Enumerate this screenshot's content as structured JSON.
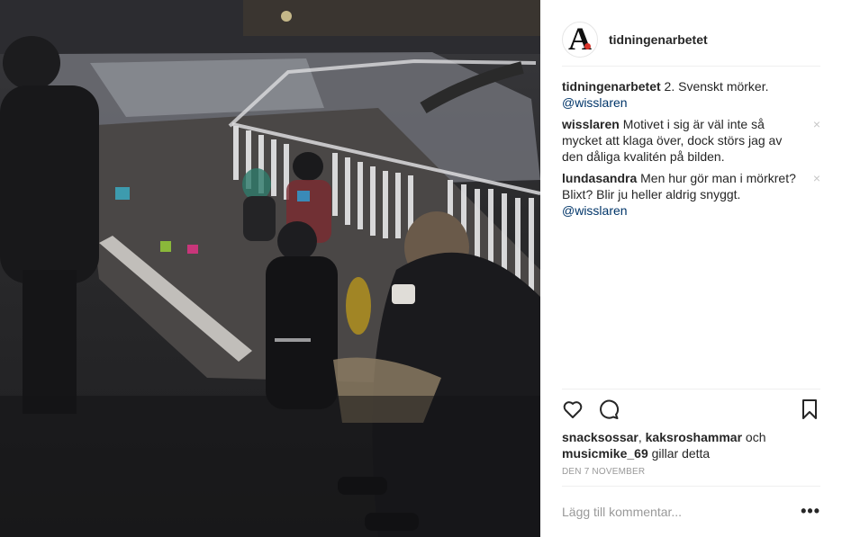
{
  "post": {
    "username": "tidningenarbetet",
    "avatar_letter": "A",
    "accent_color": "#d9342b",
    "caption_author": "tidningenarbetet",
    "caption_text": " 2. Svenskt mörker.",
    "caption_mention": "@wisslaren"
  },
  "comments": [
    {
      "author": "wisslaren",
      "text": " Motivet i sig är väl inte så mycket att klaga över, dock störs jag av den dåliga kvalitén på bilden.",
      "mention": "",
      "close": "×"
    },
    {
      "author": "lundasandra",
      "text": " Men hur gör man i mörkret? Blixt? Blir ju heller aldrig snyggt.",
      "mention": "@wisslaren",
      "close": "×"
    }
  ],
  "actions": {
    "like_icon": "heart-icon",
    "comment_icon": "speech-bubble-icon",
    "save_icon": "bookmark-icon"
  },
  "likes": {
    "user1": "snacksossar",
    "sep": ", ",
    "user2": "kaksroshammar",
    "and": " och",
    "user3": "musicmike_69",
    "suffix": " gillar detta"
  },
  "date": "DEN 7 NOVEMBER",
  "add_comment": {
    "placeholder": "Lägg till kommentar...",
    "more_label": "•••"
  }
}
